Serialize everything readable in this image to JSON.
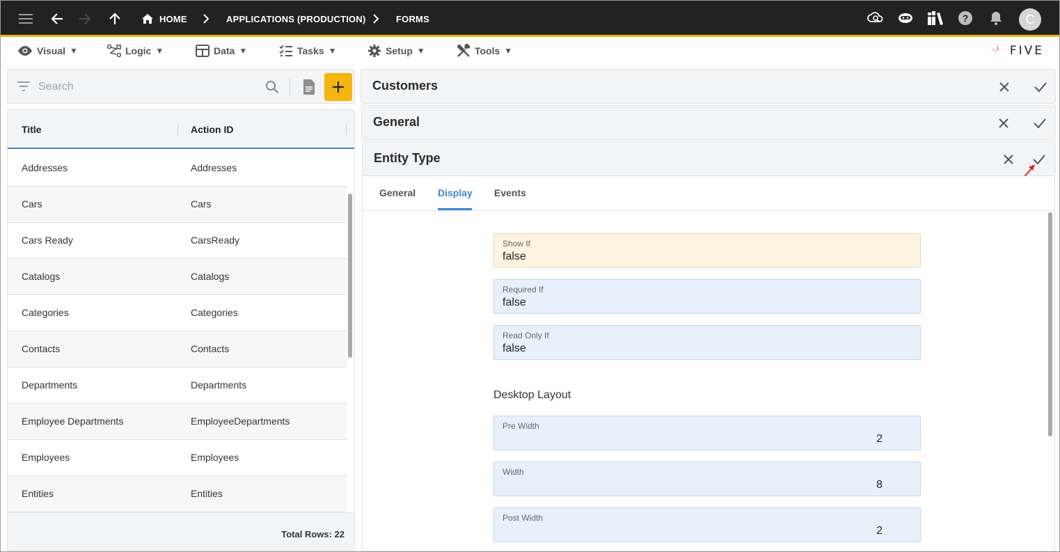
{
  "topbar": {
    "breadcrumbs": [
      "HOME",
      "APPLICATIONS (PRODUCTION)",
      "FORMS"
    ],
    "avatar_letter": "C",
    "icons": [
      "menu-icon",
      "back-arrow-icon",
      "forward-arrow-icon",
      "up-arrow-icon",
      "home-icon",
      "cloud-search-icon",
      "chatbot-icon",
      "library-icon",
      "help-icon",
      "bell-icon"
    ],
    "accent_color": "#f5b40e"
  },
  "menubar": {
    "items": [
      "Visual",
      "Logic",
      "Data",
      "Tasks",
      "Setup",
      "Tools"
    ],
    "caret": "▼",
    "brand": "FIVE"
  },
  "left": {
    "search_placeholder": "Search",
    "columns": [
      "Title",
      "Action ID"
    ],
    "rows": [
      {
        "title": "Addresses",
        "action_id": "Addresses"
      },
      {
        "title": "Cars",
        "action_id": "Cars"
      },
      {
        "title": "Cars Ready",
        "action_id": "CarsReady"
      },
      {
        "title": "Catalogs",
        "action_id": "Catalogs"
      },
      {
        "title": "Categories",
        "action_id": "Categories"
      },
      {
        "title": "Contacts",
        "action_id": "Contacts"
      },
      {
        "title": "Departments",
        "action_id": "Departments"
      },
      {
        "title": "Employee Departments",
        "action_id": "EmployeeDepartments"
      },
      {
        "title": "Employees",
        "action_id": "Employees"
      },
      {
        "title": "Entities",
        "action_id": "Entities"
      }
    ],
    "total_rows": "Total Rows: 22"
  },
  "panels": [
    {
      "title": "Customers"
    },
    {
      "title": "General"
    },
    {
      "title": "Entity Type"
    }
  ],
  "form": {
    "tabs": [
      "General",
      "Display",
      "Events"
    ],
    "active_tab": "Display",
    "fields": {
      "show_if": {
        "label": "Show If",
        "value": "false"
      },
      "required_if": {
        "label": "Required If",
        "value": "false"
      },
      "read_only_if": {
        "label": "Read Only If",
        "value": "false"
      },
      "pre_width": {
        "label": "Pre Width",
        "value": "2"
      },
      "width": {
        "label": "Width",
        "value": "8"
      },
      "post_width": {
        "label": "Post Width",
        "value": "2"
      }
    },
    "section_desktop_layout": "Desktop Layout"
  },
  "colors": {
    "active_tab": "#3f86d0",
    "field_bg": "#e8f1fb",
    "field_warn_bg": "#fdf3e1",
    "annotation_arrow": "#e02020"
  }
}
